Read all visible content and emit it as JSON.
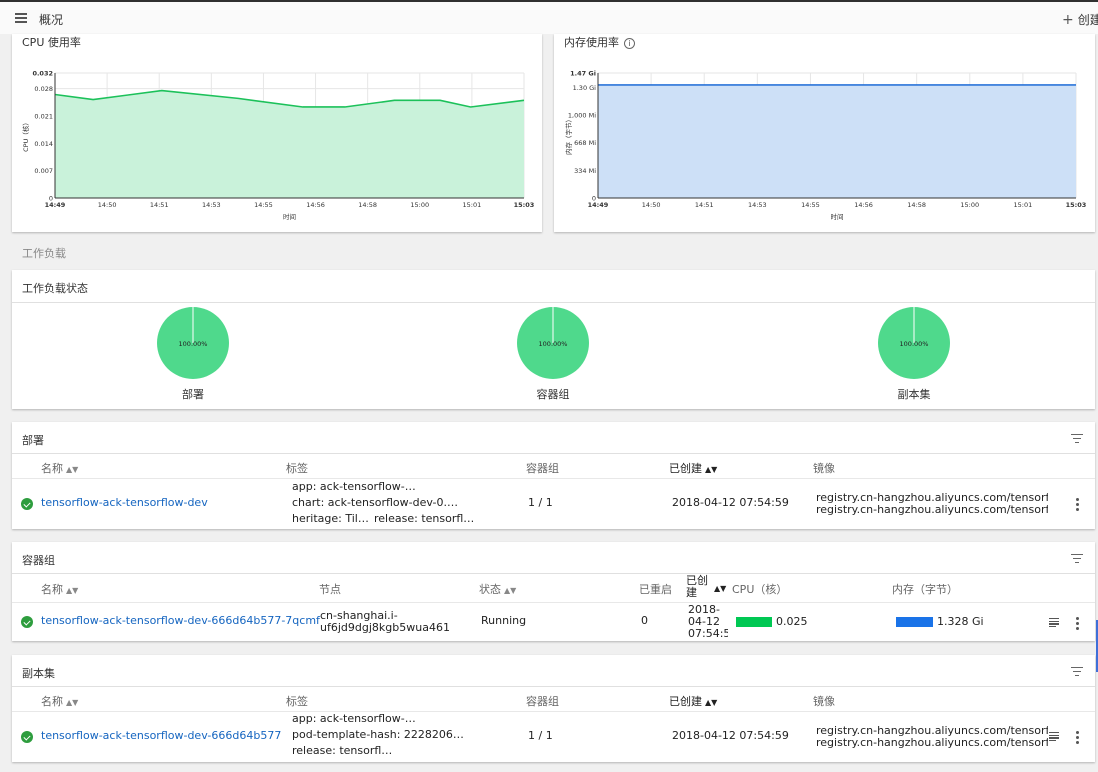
{
  "toolbar": {
    "title": "概况",
    "create_label": "创建",
    "menu_icon": "hamburger-menu-icon"
  },
  "cpu_card": {
    "title": "CPU 使用率"
  },
  "mem_card": {
    "title": "内存使用率"
  },
  "section_workloads": "工作负载",
  "workload_status": {
    "title": "工作负载状态",
    "pies": [
      {
        "pct_label": "100.00%",
        "label": "部署",
        "value": 100,
        "color": "#4fd98c"
      },
      {
        "pct_label": "100.00%",
        "label": "容器组",
        "value": 100,
        "color": "#4fd98c"
      },
      {
        "pct_label": "100.00%",
        "label": "副本集",
        "value": 100,
        "color": "#4fd98c"
      }
    ]
  },
  "deployments": {
    "title": "部署",
    "columns": {
      "name": "名称",
      "labels": "标签",
      "pods": "容器组",
      "created": "已创建",
      "image": "镜像"
    },
    "row": {
      "name": "tensorflow-ack-tensorflow-dev",
      "label1": "app: ack-tensorflow-…",
      "label2": "chart: ack-tensorflow-dev-0.…",
      "label3": "heritage: Til…",
      "label4": "release: tensorfl…",
      "pods": "1 / 1",
      "created": "2018-04-12 07:54:59",
      "image1": "registry.cn-hangzhou.aliyuncs.com/tensorflow-s",
      "image2": "registry.cn-hangzhou.aliyuncs.com/tensorflow-s"
    }
  },
  "pods": {
    "title": "容器组",
    "columns": {
      "name": "名称",
      "node": "节点",
      "status": "状态",
      "restarts": "已重启",
      "created_1": "已创",
      "created_2": "建",
      "cpu": "CPU（核）",
      "memory": "内存（字节）"
    },
    "row": {
      "name": "tensorflow-ack-tensorflow-dev-666d64b577-7qcmf",
      "node1": "cn-shanghai.i-",
      "node2": "uf6jd9dgj8kgb5wua461",
      "status": "Running",
      "restarts": "0",
      "created1": "2018-",
      "created2": "04-12",
      "created3": "07:54:5",
      "cpu": "0.025",
      "cpu_bar_color": "#00c853",
      "memory": "1.328 Gi",
      "mem_bar_color": "#1a73e8"
    }
  },
  "replicasets": {
    "title": "副本集",
    "columns": {
      "name": "名称",
      "labels": "标签",
      "pods": "容器组",
      "created": "已创建",
      "image": "镜像"
    },
    "row": {
      "name": "tensorflow-ack-tensorflow-dev-666d64b577",
      "label1": "app: ack-tensorflow-…",
      "label2": "pod-template-hash: 2228206…",
      "label3": "release: tensorfl…",
      "pods": "1 / 1",
      "created": "2018-04-12 07:54:59",
      "image1": "registry.cn-hangzhou.aliyuncs.com/tensorflow-s",
      "image2": "registry.cn-hangzhou.aliyuncs.com/tensorflow-s"
    }
  },
  "chart_data": [
    {
      "type": "area",
      "title": "CPU 使用率",
      "xlabel": "时间",
      "ylabel": "CPU（核）",
      "x_ticks": [
        "14:49",
        "14:50",
        "14:51",
        "14:53",
        "14:55",
        "14:56",
        "14:58",
        "15:00",
        "15:01",
        "15:03"
      ],
      "y_ticks": [
        "0",
        "0.007",
        "0.014",
        "0.021",
        "0.028",
        "0.032"
      ],
      "ylim": [
        0,
        0.032
      ],
      "x": [
        0,
        1,
        2.8,
        4.8,
        6.5,
        7.6,
        8.9,
        10.1,
        10.9,
        12.3
      ],
      "values": [
        0.0265,
        0.0252,
        0.0275,
        0.0255,
        0.0233,
        0.0233,
        0.025,
        0.025,
        0.0233,
        0.025
      ],
      "color": "#1cc15a",
      "fill": "#c9f2da",
      "grid": true
    },
    {
      "type": "area",
      "title": "内存使用率",
      "xlabel": "时间",
      "ylabel": "内存（字节）",
      "x_ticks": [
        "14:49",
        "14:50",
        "14:51",
        "14:53",
        "14:55",
        "14:56",
        "14:58",
        "15:00",
        "15:01",
        "15:03"
      ],
      "y_ticks": [
        "0",
        "334 Mi",
        "668 Mi",
        "1,000 Mi",
        "1.30 Gi",
        "1.47 Gi"
      ],
      "ylim": [
        0,
        1.47
      ],
      "x": [
        0,
        14
      ],
      "values": [
        1.33,
        1.33
      ],
      "color": "#2b74d9",
      "fill": "#cde0f7",
      "grid": true
    }
  ]
}
